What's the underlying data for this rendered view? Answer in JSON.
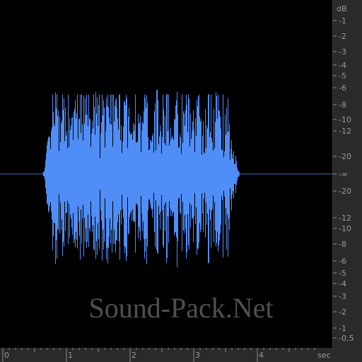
{
  "waveform": {
    "color": "#4f8ef7",
    "center_line_color": "#3a6fd0",
    "background": "#000000",
    "start_sec": 0.65,
    "end_sec": 3.7,
    "peak_db": -6
  },
  "db_ruler": {
    "unit": "dB",
    "top_labels": [
      "-1",
      "-2",
      "-3",
      "-4",
      "-5",
      "-6",
      "-8",
      "-10",
      "-12",
      "-20"
    ],
    "center_label": "-∞",
    "bottom_labels": [
      "-20",
      "-12",
      "-10",
      "-8",
      "-6",
      "-5",
      "-4",
      "-3",
      "-2",
      "-1",
      "-0,5"
    ]
  },
  "time_ruler": {
    "unit": "sec",
    "labels": [
      "0",
      "1",
      "2",
      "3",
      "4"
    ]
  },
  "watermark": "Sound-Pack.Net"
}
